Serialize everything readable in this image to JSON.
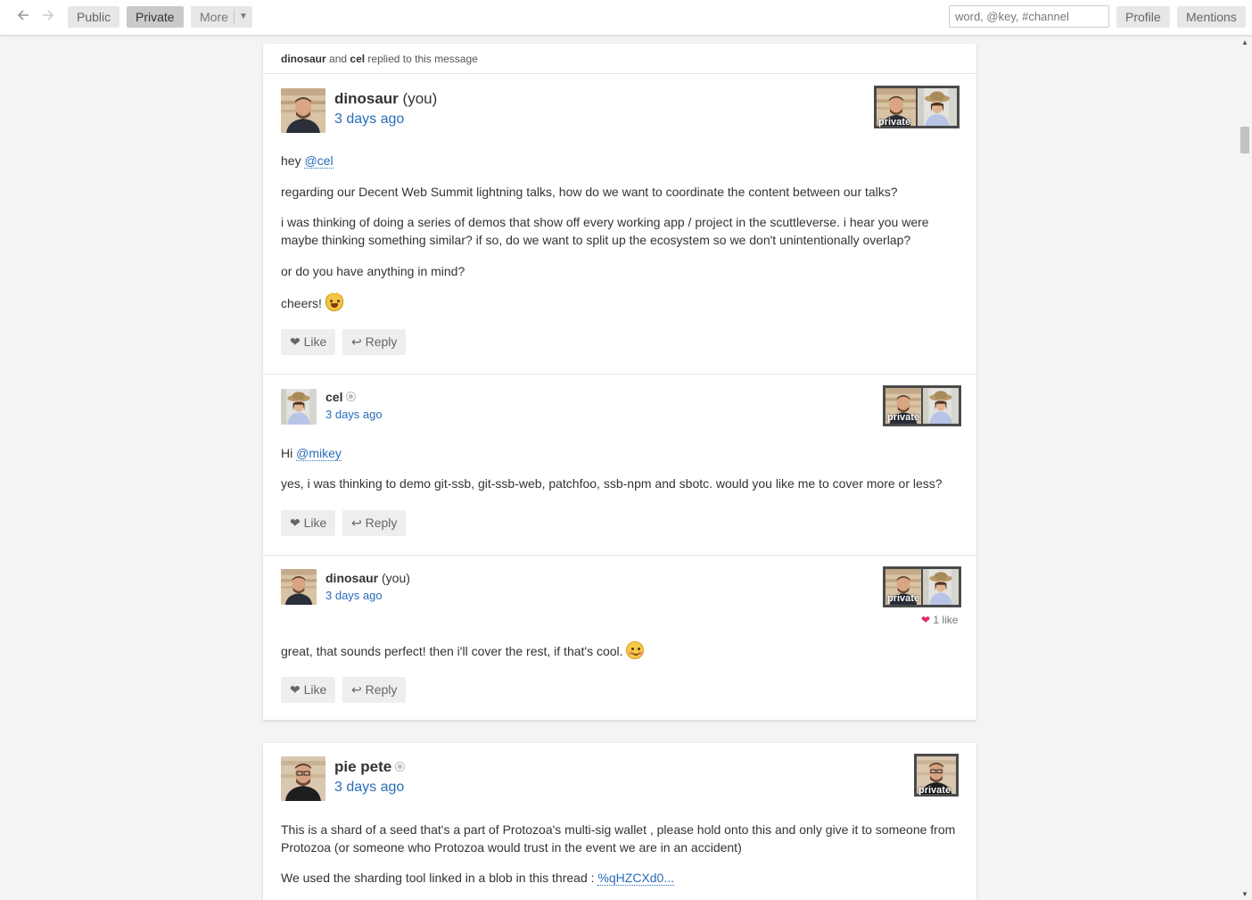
{
  "topbar": {
    "back_icon": "arrow-left-icon",
    "forward_icon": "arrow-right-icon",
    "tabs": [
      {
        "label": "Public",
        "active": false
      },
      {
        "label": "Private",
        "active": true
      },
      {
        "label": "More",
        "active": false
      }
    ],
    "search_placeholder": "word, @key, #channel",
    "profile_label": "Profile",
    "mentions_label": "Mentions"
  },
  "thread": {
    "replied_by": [
      "dinosaur",
      "cel"
    ],
    "replied_and": "and",
    "replied_suffix": "replied to this message",
    "private_label": "private",
    "like_label": "❤ Like",
    "reply_label": "↩ Reply",
    "messages": [
      {
        "author": "dinosaur",
        "you": "(you)",
        "time": "3 days ago",
        "greeting_prefix": "hey ",
        "mention": "@cel",
        "paragraphs": [
          "regarding our Decent Web Summit lightning talks, how do we want to coordinate the content between our talks?",
          "i was thinking of doing a series of demos that show off every working app / project in the scuttleverse. i hear you were maybe thinking something similar? if so, do we want to split up the ecosystem so we don't unintentionally overlap?",
          "or do you have anything in mind?",
          "cheers!"
        ],
        "emoji": "smiley-cat-icon"
      },
      {
        "author": "cel",
        "time": "3 days ago",
        "greeting_prefix": "Hi ",
        "mention": "@mikey",
        "paragraphs": [
          "yes, i was thinking to demo git-ssb, git-ssb-web, patchfoo, ssb-npm and sbotc. would you like me to cover more or less?"
        ]
      },
      {
        "author": "dinosaur",
        "you": "(you)",
        "time": "3 days ago",
        "likes": "1 like",
        "paragraphs": [
          "great, that sounds perfect! then i'll cover the rest, if that's cool."
        ],
        "emoji": "blush-smile-icon"
      }
    ]
  },
  "pete": {
    "author": "pie pete",
    "time": "3 days ago",
    "private_label": "private",
    "paragraphs": [
      "This is a shard of a seed that's a part of Protozoa's multi-sig wallet , please hold onto this and only give it to someone from Protozoa (or someone who Protozoa would trust in the event we are in an accident)"
    ],
    "blob_prefix": "We used the sharding tool linked in a blob in this thread : ",
    "blob_link": "%qHZCXd0..."
  },
  "colors": {
    "link": "#2a6db8",
    "like_heart": "#e2246b",
    "background": "#f4f4f4"
  }
}
